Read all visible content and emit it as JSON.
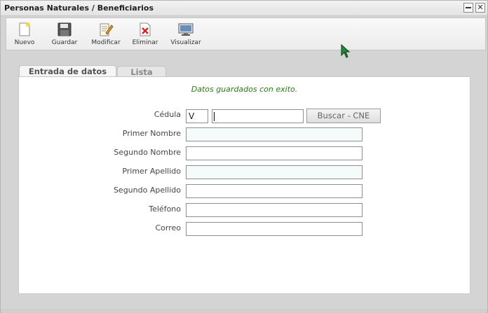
{
  "window": {
    "title": "Personas Naturales / Beneficiarios"
  },
  "toolbar": {
    "buttons": [
      {
        "label": "Nuevo",
        "icon": "new-document-icon"
      },
      {
        "label": "Guardar",
        "icon": "floppy-disk-icon"
      },
      {
        "label": "Modificar",
        "icon": "edit-document-icon"
      },
      {
        "label": "Eliminar",
        "icon": "delete-document-icon"
      },
      {
        "label": "Visualizar",
        "icon": "monitor-icon"
      }
    ]
  },
  "tabs": [
    {
      "label": "Entrada de datos",
      "active": true
    },
    {
      "label": "Lista",
      "active": false
    }
  ],
  "form": {
    "status_message": "Datos guardados con exito.",
    "cedula": {
      "label": "Cédula",
      "prefix": "V",
      "number": "",
      "search_button": "Buscar - CNE"
    },
    "fields": [
      {
        "label": "Primer Nombre",
        "value": "",
        "required": true
      },
      {
        "label": "Segundo Nombre",
        "value": "",
        "required": false
      },
      {
        "label": "Primer Apellido",
        "value": "",
        "required": true
      },
      {
        "label": "Segundo Apellido",
        "value": "",
        "required": false
      },
      {
        "label": "Teléfono",
        "value": "",
        "required": false
      },
      {
        "label": "Correo",
        "value": "",
        "required": false
      }
    ]
  },
  "colors": {
    "status_text": "#2a7a12",
    "required_field_bg": "#f4fbfa",
    "cursor": "#1f8a3a"
  }
}
